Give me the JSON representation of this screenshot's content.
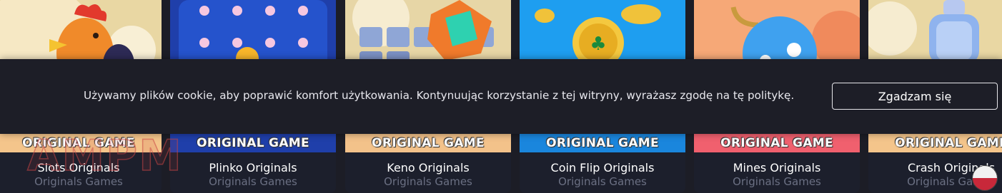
{
  "games": [
    {
      "band": "ORIGINAL GAME",
      "name": "Slots Originals",
      "category": "Originals Games",
      "band_color": "#f4c58b"
    },
    {
      "band": "ORIGINAL GAME",
      "name": "Plinko Originals",
      "category": "Originals Games",
      "band_color": "#1f3faa"
    },
    {
      "band": "ORIGINAL GAME",
      "name": "Keno Originals",
      "category": "Originals Games",
      "band_color": "#f3c28a"
    },
    {
      "band": "ORIGINAL GAME",
      "name": "Coin Flip Originals",
      "category": "Originals Games",
      "band_color": "#1a86dd"
    },
    {
      "band": "ORIGINAL GAME",
      "name": "Mines Originals",
      "category": "Originals Games",
      "band_color": "#f0606e"
    },
    {
      "band": "ORIGINAL GAME",
      "name": "Crash Originals",
      "category": "Originals Games",
      "band_color": "#f4c58b"
    }
  ],
  "cookie_banner": {
    "message": "Używamy plików cookie, aby poprawić komfort użytkowania. Kontynuując korzystanie z tej witryny, wyrażasz zgodę na tę politykę.",
    "accept_label": "Zgadzam się"
  },
  "watermark": "AMPM",
  "colors": {
    "page_bg": "#1c1d26",
    "banner_bg": "#1d1e27",
    "footer_bg": "#1c1f2c",
    "subtitle": "#6b7083"
  }
}
